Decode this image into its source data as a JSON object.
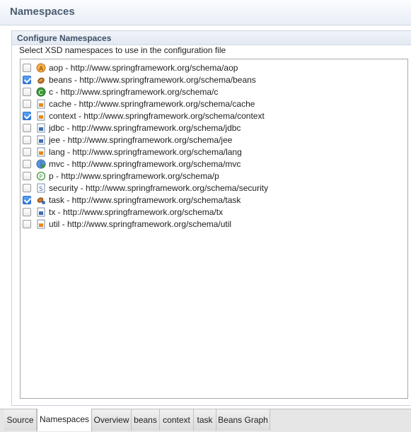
{
  "header": {
    "title": "Namespaces"
  },
  "section": {
    "title": "Configure Namespaces",
    "description": "Select XSD namespaces to use in the configuration file"
  },
  "namespaces": [
    {
      "label": "aop - http://www.springframework.org/schema/aop",
      "checked": false,
      "icon": "aop-icon"
    },
    {
      "label": "beans - http://www.springframework.org/schema/beans",
      "checked": true,
      "icon": "bean-icon"
    },
    {
      "label": "c - http://www.springframework.org/schema/c",
      "checked": false,
      "icon": "c-namespace-icon"
    },
    {
      "label": "cache - http://www.springframework.org/schema/cache",
      "checked": false,
      "icon": "xsd-file-icon"
    },
    {
      "label": "context - http://www.springframework.org/schema/context",
      "checked": true,
      "icon": "xsd-file-icon"
    },
    {
      "label": "jdbc - http://www.springframework.org/schema/jdbc",
      "checked": false,
      "icon": "xsd-file-icon"
    },
    {
      "label": "jee - http://www.springframework.org/schema/jee",
      "checked": false,
      "icon": "xsd-file-icon"
    },
    {
      "label": "lang - http://www.springframework.org/schema/lang",
      "checked": false,
      "icon": "xsd-file-icon"
    },
    {
      "label": "mvc - http://www.springframework.org/schema/mvc",
      "checked": false,
      "icon": "mvc-globe-icon"
    },
    {
      "label": "p - http://www.springframework.org/schema/p",
      "checked": false,
      "icon": "p-namespace-icon"
    },
    {
      "label": "security - http://www.springframework.org/schema/security",
      "checked": false,
      "icon": "security-icon"
    },
    {
      "label": "task - http://www.springframework.org/schema/task",
      "checked": true,
      "icon": "task-icon"
    },
    {
      "label": "tx - http://www.springframework.org/schema/tx",
      "checked": false,
      "icon": "xsd-file-icon"
    },
    {
      "label": "util - http://www.springframework.org/schema/util",
      "checked": false,
      "icon": "xsd-file-icon"
    }
  ],
  "tabs": [
    {
      "label": "Source",
      "active": false
    },
    {
      "label": "Namespaces",
      "active": true
    },
    {
      "label": "Overview",
      "active": false
    },
    {
      "label": "beans",
      "active": false
    },
    {
      "label": "context",
      "active": false
    },
    {
      "label": "task",
      "active": false
    },
    {
      "label": "Beans Graph",
      "active": false
    }
  ],
  "colors": {
    "header_title": "#4a5c73",
    "checkbox_checked": "#2f7de0",
    "icon_orange": "#e58a1f",
    "icon_blue": "#3b6fb6",
    "icon_green": "#3f9a3b"
  }
}
